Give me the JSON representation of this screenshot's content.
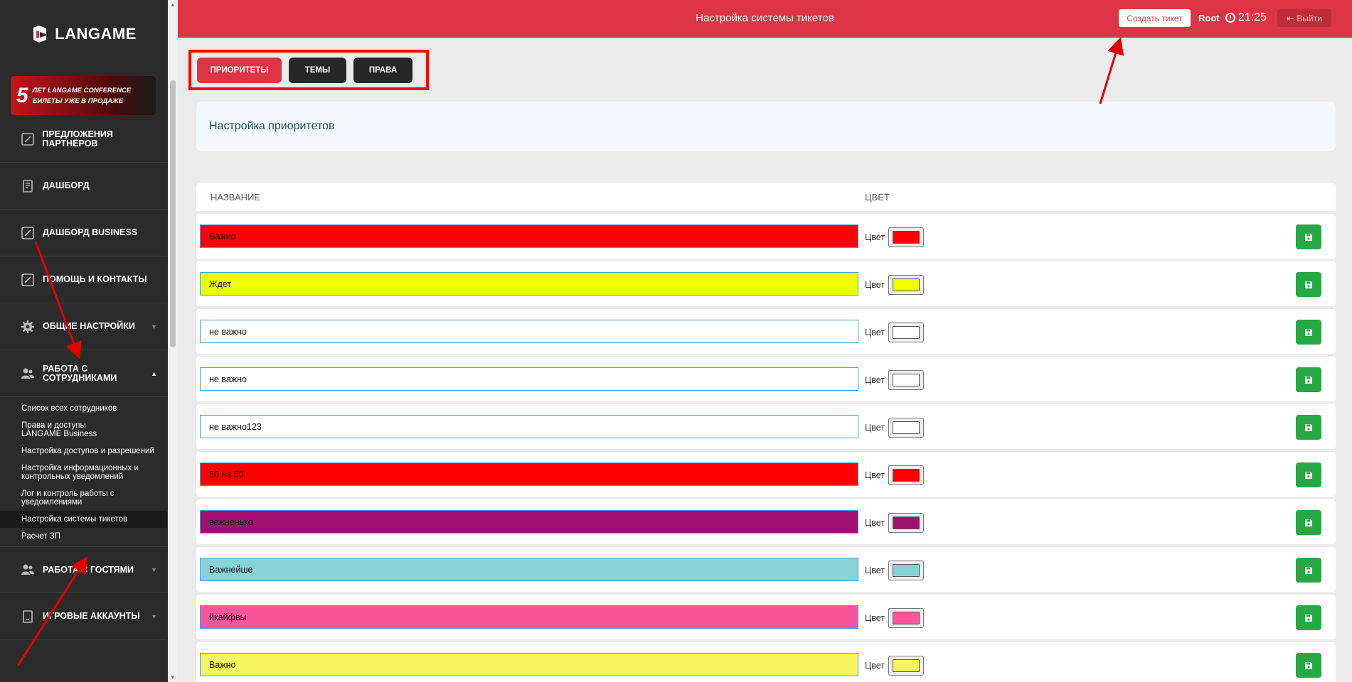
{
  "brand": {
    "logo_text": "LANGAME"
  },
  "banner": {
    "number": "5",
    "line1": "ЛЕТ LANGAME CONFERENCE",
    "line2": "БИЛЕТЫ УЖЕ В ПРОДАЖЕ"
  },
  "sidebar": {
    "items": [
      {
        "label": "Предложения партнёров",
        "icon": "edit-icon"
      },
      {
        "label": "Дашборд",
        "icon": "notebook-icon"
      },
      {
        "label": "Дашборд Business",
        "icon": "edit-icon"
      },
      {
        "label": "Помощь и контакты",
        "icon": "edit-icon"
      },
      {
        "label": "Общие настройки",
        "icon": "gear-icon",
        "caret": "▼"
      },
      {
        "label": "Работа с сотрудниками",
        "icon": "users-icon",
        "caret": "▲"
      }
    ],
    "sub_items": [
      {
        "label": "Список всех сотрудников"
      },
      {
        "label": "Права и доступы LANGAME Business"
      },
      {
        "label": "Настройка доступов и разрешений"
      },
      {
        "label": "Настройка информационных и контрольных уведомлений"
      },
      {
        "label": "Лог и контроль работы с уведомлениями"
      },
      {
        "label": "Настройка системы тикетов"
      },
      {
        "label": "Расчет ЗП"
      }
    ],
    "bottom_items": [
      {
        "label": "Работа с гостями",
        "icon": "users-icon",
        "caret": "▼"
      },
      {
        "label": "Игровые аккаунты",
        "icon": "device-icon",
        "caret": "▼"
      }
    ]
  },
  "header": {
    "title": "Настройка системы тикетов",
    "create_button": "Создать тикет",
    "user": "Root",
    "time": "21:25",
    "logout": "Выйти"
  },
  "tabs": [
    {
      "label": "ПРИОРИТЕТЫ",
      "active": true
    },
    {
      "label": "ТЕМЫ",
      "active": false
    },
    {
      "label": "ПРАВА",
      "active": false
    }
  ],
  "section_title": "Настройка приоритетов",
  "table": {
    "columns": [
      "НАЗВАНИЕ",
      "ЦВЕТ"
    ],
    "color_label": "Цвет",
    "rows": [
      {
        "name": "Важно",
        "color": "#ff0000"
      },
      {
        "name": "Ждет",
        "color": "#eeff00"
      },
      {
        "name": "не важно",
        "color": "#ffffff"
      },
      {
        "name": "не важно",
        "color": "#ffffff"
      },
      {
        "name": "не важно123",
        "color": "#ffffff"
      },
      {
        "name": "50 на 50",
        "color": "#ff0000"
      },
      {
        "name": "важненько",
        "color": "#a0106e"
      },
      {
        "name": "Важнейше",
        "color": "#87d3d8"
      },
      {
        "name": "йкайфвы",
        "color": "#fa5599"
      },
      {
        "name": "Важно",
        "color": "#f7f461"
      }
    ]
  },
  "colors": {
    "accent": "#dc3545",
    "sidebar": "#2b2b2b",
    "save": "#28a745"
  }
}
